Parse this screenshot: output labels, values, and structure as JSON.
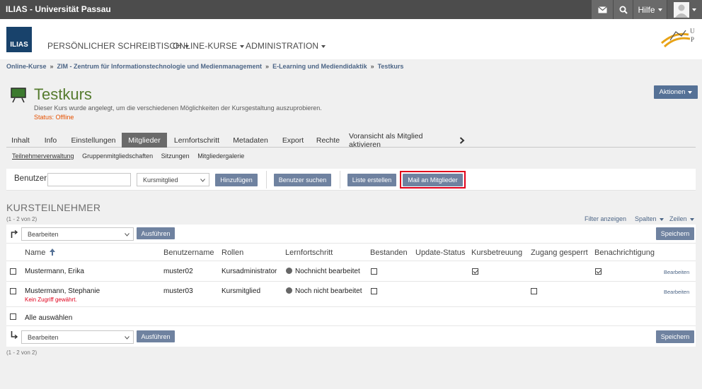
{
  "topbar": {
    "title": "ILIAS - Universität Passau",
    "help": "Hilfe"
  },
  "header": {
    "logo_text": "ILIAS",
    "nav": [
      "PERSÖNLICHER SCHREIBTISCH",
      "ONLINE-KURSE",
      "ADMINISTRATION"
    ]
  },
  "breadcrumb": [
    "Online-Kurse",
    "ZIM - Zentrum für Informationstechnologie und Medienmanagement",
    "E-Learning und Mediendidaktik",
    "Testkurs"
  ],
  "breadcrumb_sep": "»",
  "page": {
    "title": "Testkurs",
    "description": "Dieser Kurs wurde angelegt, um die verschiedenen Möglichkeiten der Kursgestaltung auszuprobieren.",
    "status": "Status: Offline",
    "actions": "Aktionen"
  },
  "tabs": [
    "Inhalt",
    "Info",
    "Einstellungen",
    "Mitglieder",
    "Lernfortschritt",
    "Metadaten",
    "Export",
    "Rechte",
    "Voransicht als Mitglied aktivieren"
  ],
  "subtabs": [
    "Teilnehmerverwaltung",
    "Gruppenmitgliedschaften",
    "Sitzungen",
    "Mitgliedergalerie"
  ],
  "toolbar": {
    "user_label": "Benutzer",
    "user_value": "",
    "role_select": "Kursmitglied",
    "add": "Hinzufügen",
    "search": "Benutzer suchen",
    "list": "Liste erstellen",
    "mail": "Mail an Mitglieder"
  },
  "section": {
    "title": "KURSTEILNEHMER",
    "count": "(1 - 2 von 2)"
  },
  "table_controls": {
    "filter": "Filter anzeigen",
    "columns": "Spalten",
    "rows": "Zeilen"
  },
  "bulk": {
    "select": "Bearbeiten",
    "execute": "Ausführen",
    "save": "Speichern"
  },
  "columns": [
    "Name",
    "Benutzername",
    "Rollen",
    "Lernfortschritt",
    "Bestanden",
    "Update-Status",
    "Kursbetreuung",
    "Zugang gesperrt",
    "Benachrichtigung"
  ],
  "rows": [
    {
      "name": "Mustermann, Erika",
      "login": "muster02",
      "role": "Kursadministrator",
      "progress": "Nochnicht bearbeitet",
      "note": "",
      "edit": "Bearbeiten"
    },
    {
      "name": "Mustermann, Stephanie",
      "login": "muster03",
      "role": "Kursmitglied",
      "progress": "Noch nicht bearbeitet",
      "note": "Kein Zugriff gewährt.",
      "edit": "Bearbeiten"
    }
  ],
  "select_all": "Alle auswählen",
  "colors": {
    "topbar": "#4c4c4c",
    "accent": "#557196",
    "title": "#557b2e",
    "status": "#e65100",
    "highlight": "#e0001b"
  }
}
